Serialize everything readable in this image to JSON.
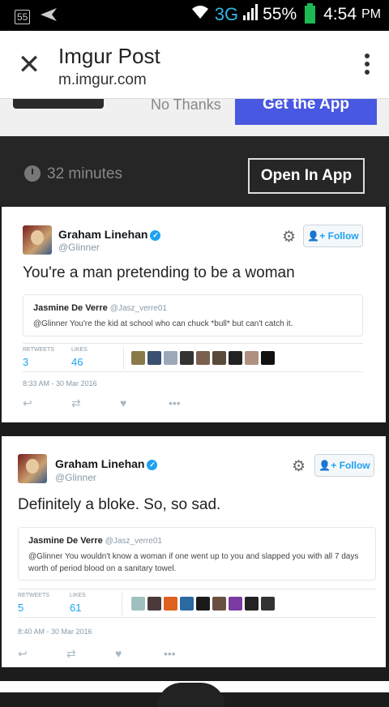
{
  "status_bar": {
    "notif_count": "55",
    "network": "3G",
    "battery": "55%",
    "time": "4:54",
    "ampm": "PM"
  },
  "header": {
    "title": "Imgur Post",
    "url": "m.imgur.com"
  },
  "banner": {
    "no_thanks": "No Thanks",
    "get_app": "Get the App"
  },
  "timebar": {
    "time_ago": "32 minutes",
    "open_app": "Open In App"
  },
  "tweets": [
    {
      "name": "Graham Linehan",
      "handle": "@Glinner",
      "follow_label": "Follow",
      "text": "You're a man pretending to be a woman",
      "quote": {
        "name": "Jasmine De Verre",
        "handle": "@Jasz_verre01",
        "text": "@Glinner You're the kid at school who can chuck *bull* but can't catch it."
      },
      "retweets_label": "RETWEETS",
      "retweets": "3",
      "likes_label": "LIKES",
      "likes": "46",
      "date": "8:33 AM - 30 Mar 2016"
    },
    {
      "name": "Graham Linehan",
      "handle": "@Glinner",
      "follow_label": "Follow",
      "text": "Definitely a bloke. So, so sad.",
      "quote": {
        "name": "Jasmine De Verre",
        "handle": "@Jasz_verre01",
        "text": "@Glinner You wouldn't know a woman if one went up to you and slapped you with all 7 days worth of period blood on a sanitary towel."
      },
      "retweets_label": "RETWEETS",
      "retweets": "5",
      "likes_label": "LIKES",
      "likes": "61",
      "date": "8:40 AM - 30 Mar 2016"
    }
  ],
  "colors": {
    "accent_blue": "#1da1f2",
    "get_app_button": "#4958e0",
    "battery": "#1db954",
    "network": "#33b5e5"
  }
}
